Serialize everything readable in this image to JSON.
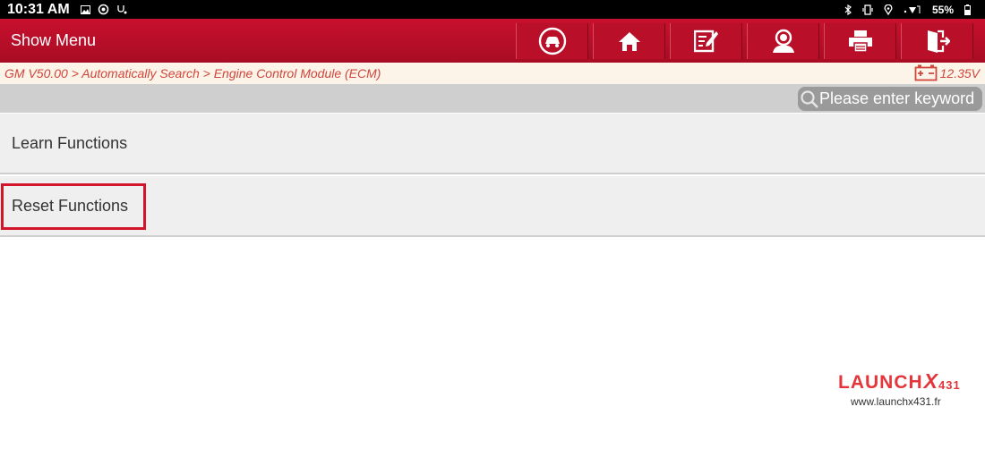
{
  "status_bar": {
    "time": "10:31 AM",
    "battery": "55%"
  },
  "toolbar": {
    "title": "Show Menu",
    "buttons": [
      {
        "name": "diagnose-button",
        "icon": "car-icon"
      },
      {
        "name": "home-button",
        "icon": "home-icon"
      },
      {
        "name": "edit-button",
        "icon": "edit-icon"
      },
      {
        "name": "account-button",
        "icon": "person-icon"
      },
      {
        "name": "print-button",
        "icon": "printer-icon"
      },
      {
        "name": "exit-button",
        "icon": "exit-icon"
      }
    ]
  },
  "breadcrumb": {
    "path": "GM V50.00 > Automatically Search > Engine Control Module (ECM)",
    "voltage": "12.35V"
  },
  "search": {
    "placeholder": "Please enter keyword"
  },
  "menu": {
    "items": [
      {
        "label": "Learn Functions"
      },
      {
        "label": "Reset Functions"
      }
    ]
  },
  "watermark": {
    "brand": "LAUNCH",
    "model_x": "X",
    "model_num": "431",
    "url": "www.launchx431.fr"
  },
  "colors": {
    "toolbar_red": "#c8102e",
    "breadcrumb_text": "#d0453c",
    "highlight": "#d4142b"
  }
}
